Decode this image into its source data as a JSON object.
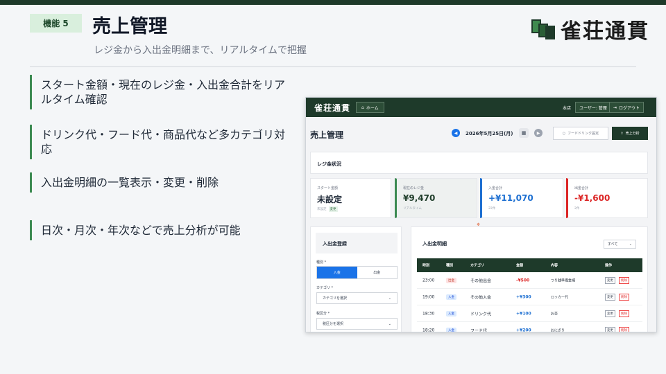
{
  "slide": {
    "badge": "機能 5",
    "title": "売上管理",
    "subtitle": "レジ金から入出金明細まで、リアルタイムで把握",
    "logo_text": "雀荘通貫",
    "accent_color": "#3c8a52",
    "header_bar_color": "#1e3a2a"
  },
  "features": [
    "スタート金額・現在のレジ金・入出金合計をリアルタイム確認",
    "ドリンク代・フード代・商品代など多カテゴリ対応",
    "入出金明細の一覧表示・変更・削除",
    "日次・月次・年次などで売上分析が可能"
  ],
  "app": {
    "nav": {
      "brand": "雀荘通貫",
      "home": "ホーム",
      "home_icon": "home-icon",
      "store": "本店",
      "user": "ユーザー: 管理",
      "logout": "ログアウト",
      "logout_icon": "logout-icon"
    },
    "page_title": "売上管理",
    "date": "2026年5月25日(月)",
    "food_drink_button": "フードドリンク設定",
    "analysis_button": "売上分析",
    "register_section": "レジ金状況",
    "stats": {
      "start": {
        "label": "スタート金額",
        "value": "未設定",
        "sub": "未設定",
        "change": "変更"
      },
      "current": {
        "label": "現在のレジ金",
        "value": "¥9,470",
        "sub": "リアルタイム"
      },
      "income": {
        "label": "入金合計",
        "value": "+¥11,070",
        "sub": "22件"
      },
      "outgo": {
        "label": "出金合計",
        "value": "-¥1,600",
        "sub": "2件"
      }
    },
    "form": {
      "title": "入出金登録",
      "type_label": "種別 *",
      "type_in": "入金",
      "type_out": "出金",
      "category_label": "カテゴリ *",
      "category_placeholder": "カテゴリを選択",
      "tax_label": "税区分 *",
      "tax_placeholder": "税区分を選択"
    },
    "table": {
      "title": "入出金明細",
      "filter": "すべて",
      "headers": [
        "時刻",
        "種別",
        "カテゴリ",
        "金額",
        "内容",
        "操作"
      ],
      "rows": [
        {
          "time": "23:00",
          "type": "出金",
          "category": "その他出金",
          "amount": "-¥500",
          "content": "つり銭準備金補",
          "edit": "変更",
          "delete": "削除"
        },
        {
          "time": "19:00",
          "type": "入金",
          "category": "その他入金",
          "amount": "+¥300",
          "content": "ロッカー代",
          "edit": "変更",
          "delete": "削除"
        },
        {
          "time": "18:30",
          "type": "入金",
          "category": "ドリンク代",
          "amount": "+¥100",
          "content": "お茶",
          "edit": "変更",
          "delete": "削除"
        },
        {
          "time": "18:20",
          "type": "入金",
          "category": "フード代",
          "amount": "+¥200",
          "content": "おにぎり",
          "edit": "変更",
          "delete": "削除"
        }
      ]
    }
  }
}
